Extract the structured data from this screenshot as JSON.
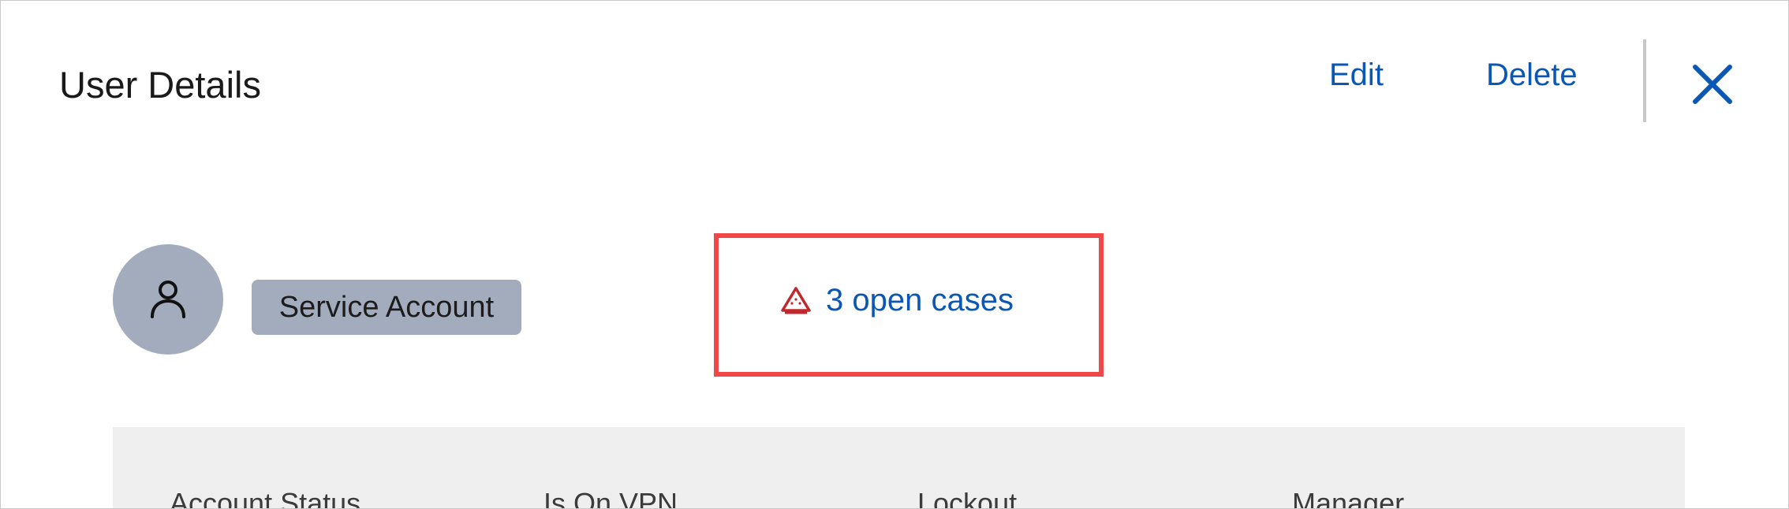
{
  "header": {
    "title": "User Details",
    "edit_label": "Edit",
    "delete_label": "Delete"
  },
  "profile": {
    "account_type_badge": "Service Account"
  },
  "alerts": {
    "open_cases_label": "3 open cases"
  },
  "details": {
    "fields": [
      {
        "label": "Account Status"
      },
      {
        "label": "Is On VPN"
      },
      {
        "label": "Lockout"
      },
      {
        "label": "Manager"
      }
    ]
  },
  "colors": {
    "link": "#0b57b5",
    "warning": "#c0282d",
    "highlight": "#ef4848",
    "avatar_bg": "#a3acbd",
    "panel_bg": "#efefef"
  },
  "icons": {
    "close": "close-icon",
    "avatar": "user-icon",
    "warning": "warning-triangle-icon"
  }
}
